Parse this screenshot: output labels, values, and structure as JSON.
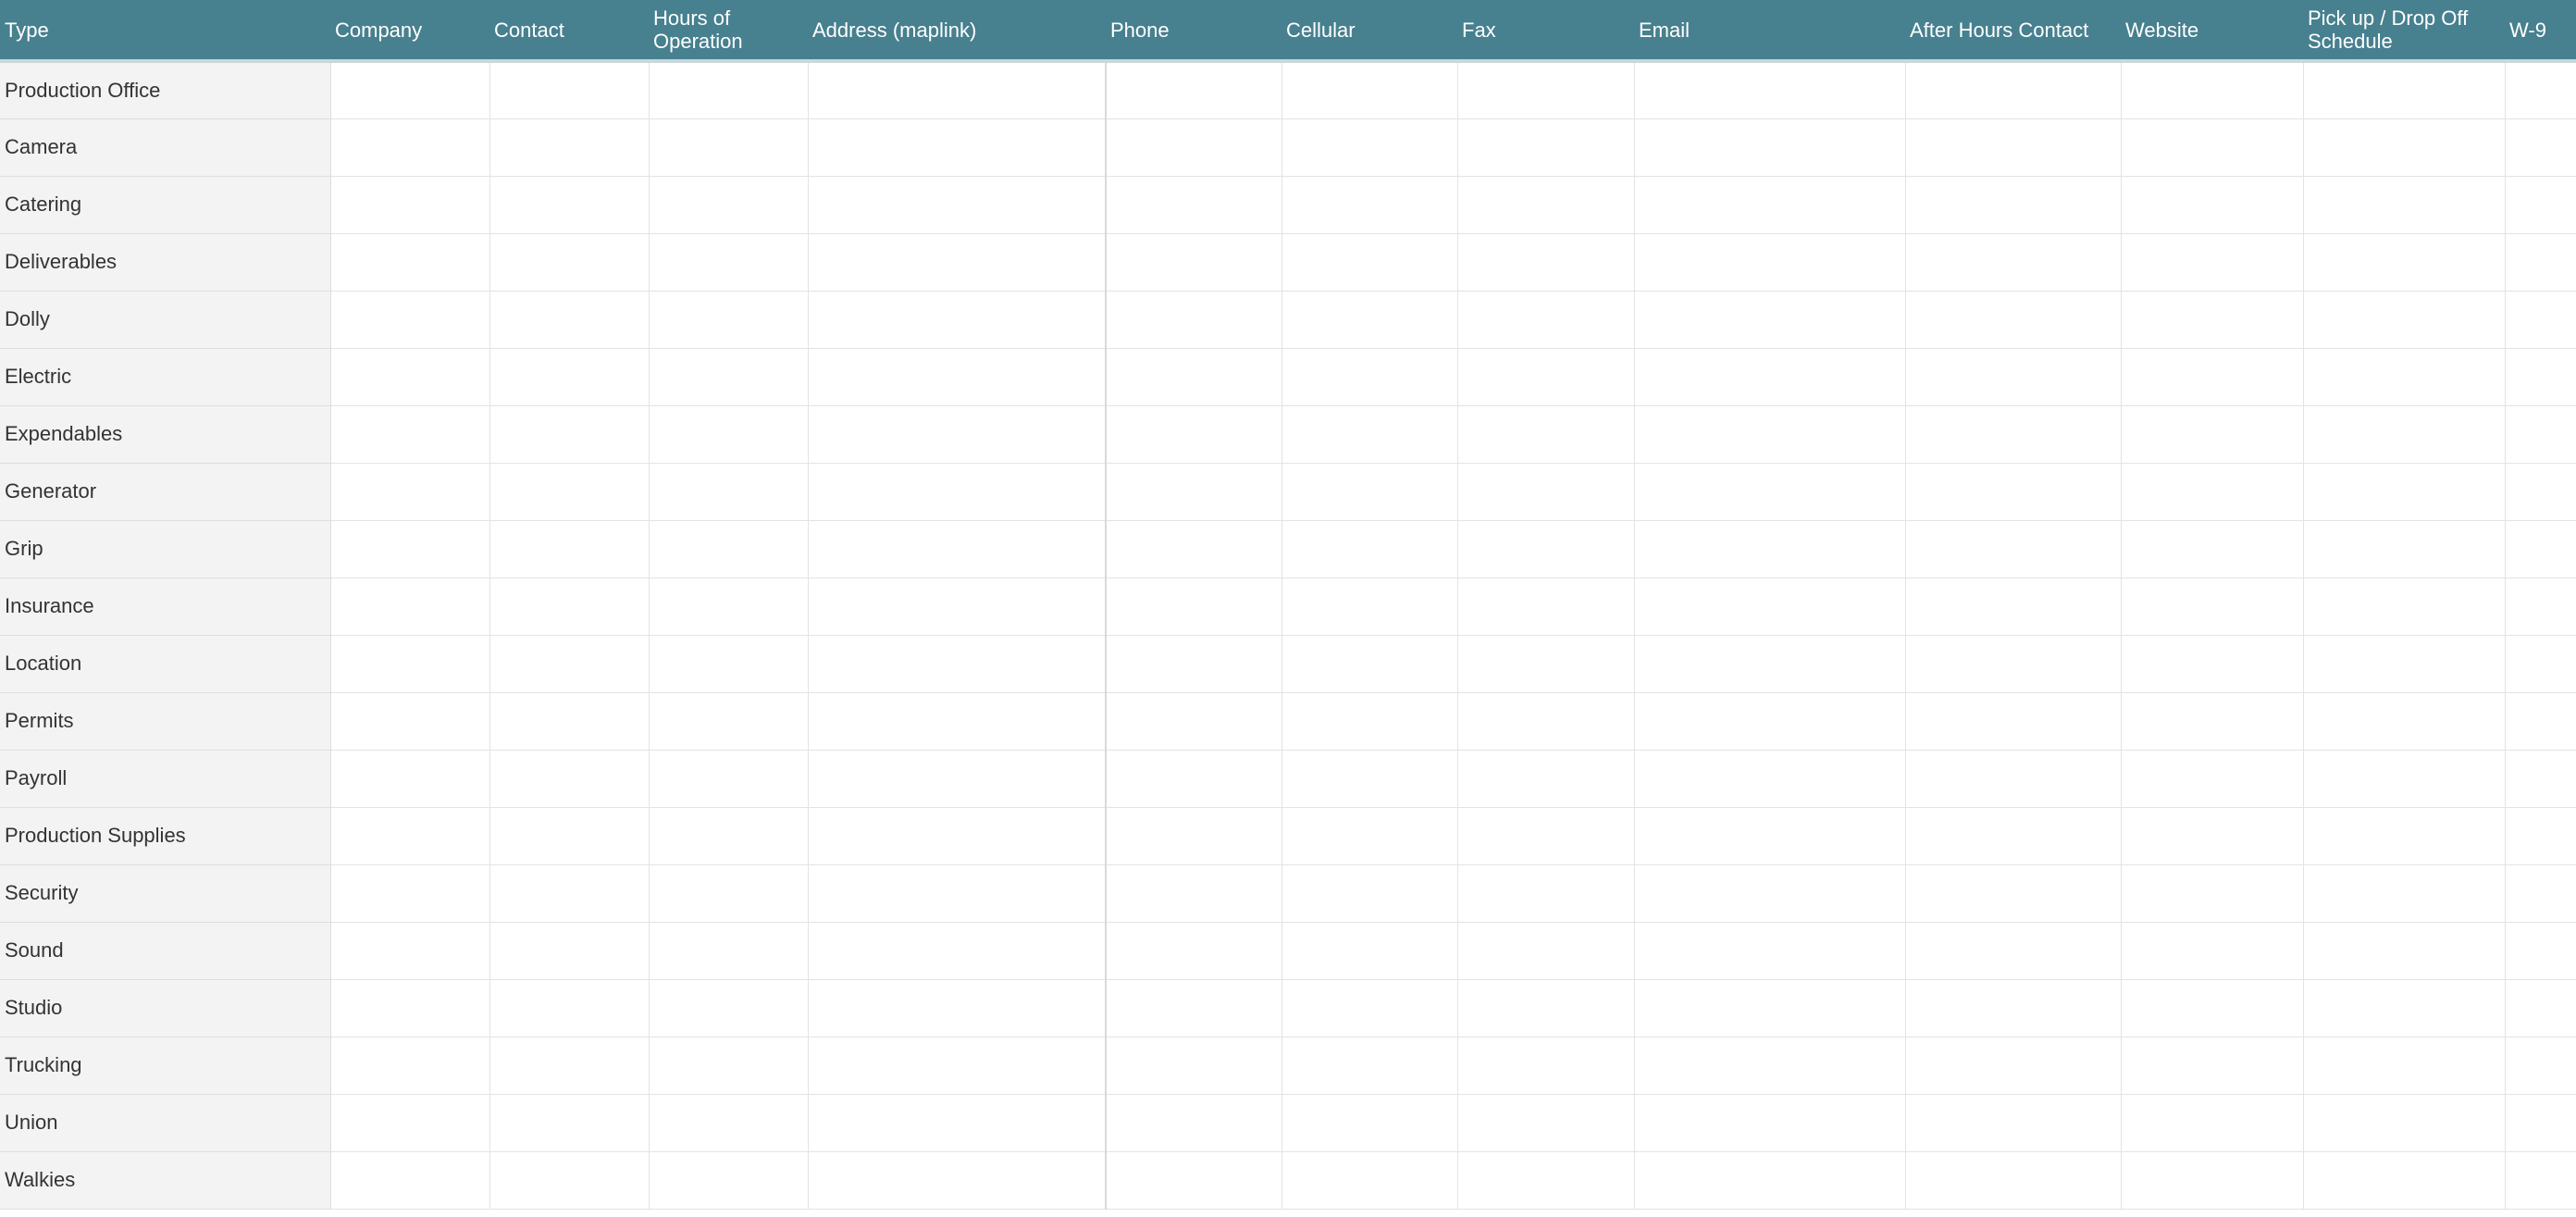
{
  "sheet": {
    "columns": [
      "Type",
      "Company",
      "Contact",
      "Hours of Operation",
      "Address (maplink)",
      "Phone",
      "Cellular",
      "Fax",
      "Email",
      "After Hours Contact",
      "Website",
      "Pick up / Drop Off Schedule",
      "W-9"
    ],
    "rows": [
      "Production Office",
      "Camera",
      "Catering",
      "Deliverables",
      "Dolly",
      "Electric",
      "Expendables",
      "Generator",
      "Grip",
      "Insurance",
      "Location",
      "Permits",
      "Payroll",
      "Production Supplies",
      "Security",
      "Sound",
      "Studio",
      "Trucking",
      "Union",
      "Walkies"
    ]
  },
  "colors": {
    "header_background": "#47808f",
    "header_text": "#ffffff",
    "type_column_background": "#f3f3f3",
    "grid_line": "#e3e3e3"
  }
}
